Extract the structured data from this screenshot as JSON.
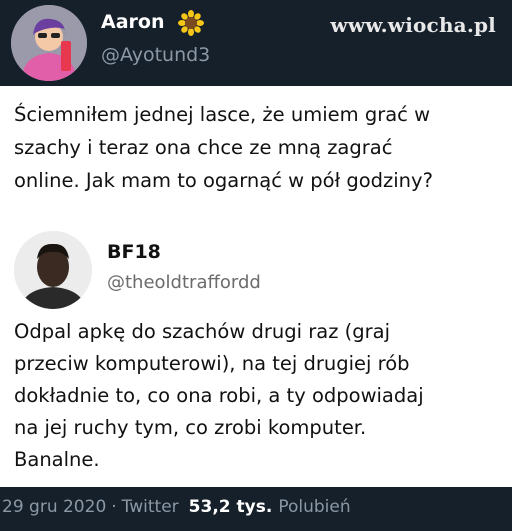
{
  "tweet": {
    "author_name": "Aaron",
    "author_handle": "@Ayotund3",
    "name_emoji_icon": "sunflower-icon",
    "text_lines": [
      "Ściemniłem jednej lasce, że umiem grać w",
      "szachy i teraz ona chce ze mną zagrać",
      "online. Jak mam to ogarnąć w pół godziny?"
    ]
  },
  "watermark": "www.wiocha.pl",
  "quoted": {
    "author_name": "BF18",
    "author_handle": "@theoldtraffordd",
    "text_lines": [
      "Odpal apkę do szachów drugi raz (graj",
      "przeciw komputerowi), na tej drugiej rób",
      "dokładnie to, co ona robi, a ty odpowiadaj",
      "na jej ruchy tym, co zrobi komputer.",
      "Banalne."
    ]
  },
  "footer": {
    "date": "29 gru 2020",
    "separator": "·",
    "source": "Twitter",
    "likes_count": "53,2 tys.",
    "likes_label": "Polubień"
  },
  "colors": {
    "dark_bg": "#15202b",
    "secondary_text": "#8b98a5"
  }
}
